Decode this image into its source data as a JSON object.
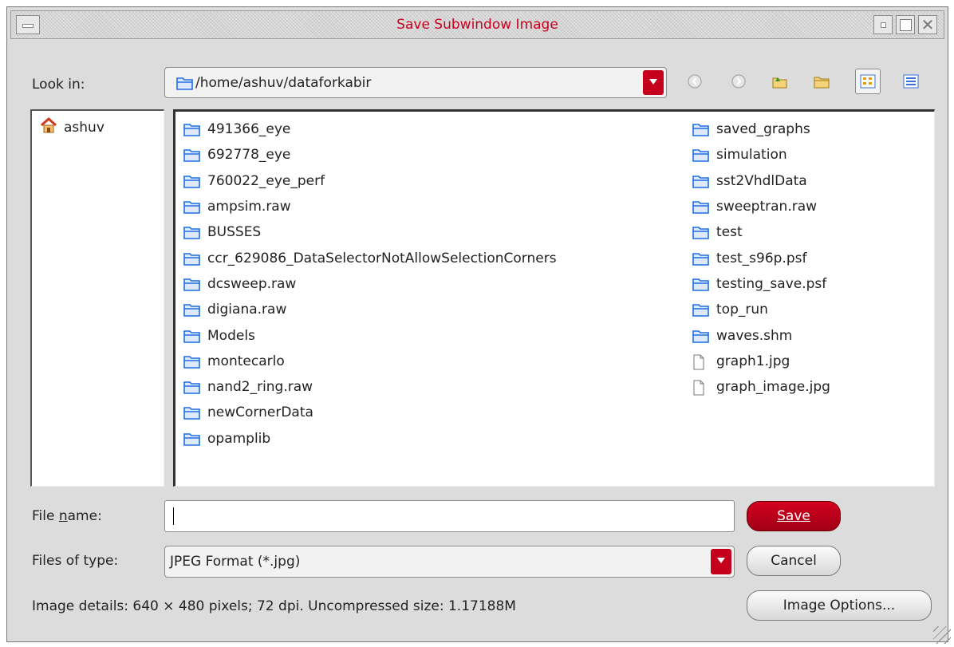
{
  "window": {
    "title": "Save Subwindow Image"
  },
  "look_in": {
    "label": "Look in:",
    "path": "/home/ashuv/dataforkabir"
  },
  "toolbar": {
    "icons": [
      "back-icon",
      "forward-icon",
      "up-folder-icon",
      "new-folder-icon",
      "list-view-icon",
      "details-view-icon"
    ]
  },
  "sidebar": {
    "items": [
      {
        "label": "ashuv",
        "icon": "home-icon"
      }
    ]
  },
  "files": {
    "col1": [
      {
        "name": "491366_eye",
        "type": "folder"
      },
      {
        "name": "692778_eye",
        "type": "folder"
      },
      {
        "name": "760022_eye_perf",
        "type": "folder"
      },
      {
        "name": "ampsim.raw",
        "type": "folder"
      },
      {
        "name": "BUSSES",
        "type": "folder"
      },
      {
        "name": "ccr_629086_DataSelectorNotAllowSelectionCorners",
        "type": "folder"
      },
      {
        "name": "dcsweep.raw",
        "type": "folder"
      },
      {
        "name": "digiana.raw",
        "type": "folder"
      },
      {
        "name": "Models",
        "type": "folder"
      },
      {
        "name": "montecarlo",
        "type": "folder"
      },
      {
        "name": "nand2_ring.raw",
        "type": "folder"
      },
      {
        "name": "newCornerData",
        "type": "folder"
      },
      {
        "name": "opamplib",
        "type": "folder"
      }
    ],
    "col2": [
      {
        "name": "saved_graphs",
        "type": "folder"
      },
      {
        "name": "simulation",
        "type": "folder"
      },
      {
        "name": "sst2VhdlData",
        "type": "folder"
      },
      {
        "name": "sweeptran.raw",
        "type": "folder"
      },
      {
        "name": "test",
        "type": "folder"
      },
      {
        "name": "test_s96p.psf",
        "type": "folder"
      },
      {
        "name": "testing_save.psf",
        "type": "folder"
      },
      {
        "name": "top_run",
        "type": "folder"
      },
      {
        "name": "waves.shm",
        "type": "folder"
      },
      {
        "name": "graph1.jpg",
        "type": "file"
      },
      {
        "name": "graph_image.jpg",
        "type": "file"
      }
    ]
  },
  "file_name": {
    "label": "File name:",
    "mnemonic": "n",
    "value": ""
  },
  "file_type": {
    "label": "Files of type:",
    "value": "JPEG Format (*.jpg)"
  },
  "buttons": {
    "save": "Save",
    "cancel": "Cancel",
    "image_options": "Image Options..."
  },
  "image_details": "Image details: 640 × 480 pixels; 72 dpi. Uncompressed size: 1.17188M",
  "colors": {
    "accent": "#c4001d",
    "title_text": "#c8001e",
    "folder_blue": "#1e6fe0"
  }
}
